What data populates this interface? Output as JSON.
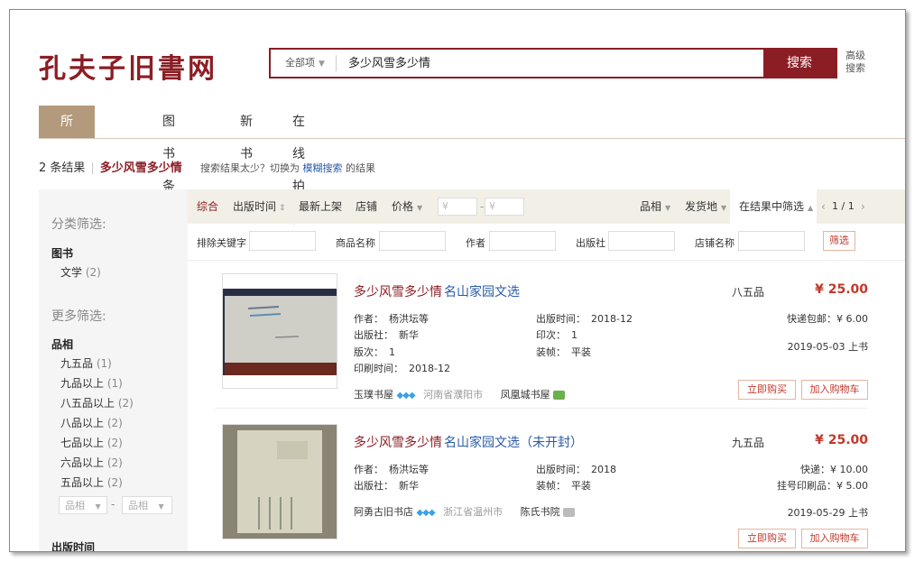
{
  "logo": "孔夫子旧書网",
  "search": {
    "scope": "全部项",
    "query": "多少风雪多少情",
    "button": "搜索",
    "advanced": "高级搜索"
  },
  "tabs": [
    "所有商品",
    "图书条目",
    "新书",
    "在线拍卖"
  ],
  "summary": {
    "count": "2 条结果",
    "keyword": "多少风雪多少情",
    "tip_prefix": "搜索结果太少？切换为",
    "tip_link": "模糊搜索",
    "tip_suffix": "的结果"
  },
  "sidebar": {
    "category_heading": "分类筛选:",
    "category_group": "图书",
    "category_items": [
      {
        "label": "文学",
        "count": "(2)"
      }
    ],
    "more_heading": "更多筛选:",
    "condition_group": "品相",
    "condition_items": [
      {
        "label": "九五品",
        "count": "(1)"
      },
      {
        "label": "九品以上",
        "count": "(1)"
      },
      {
        "label": "八五品以上",
        "count": "(2)"
      },
      {
        "label": "八品以上",
        "count": "(2)"
      },
      {
        "label": "七品以上",
        "count": "(2)"
      },
      {
        "label": "六品以上",
        "count": "(2)"
      },
      {
        "label": "五品以上",
        "count": "(2)"
      }
    ],
    "range_from": "品相",
    "range_dash": "-",
    "range_to": "品相",
    "pubtime_group": "出版时间"
  },
  "sortbar": {
    "comprehensive": "综合",
    "pubtime": "出版时间",
    "newest": "最新上架",
    "shop": "店铺",
    "price": "价格",
    "price_from": "¥",
    "price_dash": "-",
    "price_to": "¥",
    "condition": "品相",
    "ship_from": "发货地",
    "in_results": "在结果中筛选",
    "page": "1 / 1"
  },
  "filterrow": {
    "exclude": "排除关键字",
    "name": "商品名称",
    "author": "作者",
    "publisher": "出版社",
    "shopname": "店铺名称",
    "button": "筛选"
  },
  "items": [
    {
      "title_main": "多少风雪多少情",
      "title_sub": "名山家园文选",
      "author_k": "作者：",
      "author_v": "杨洪坛等",
      "pubtime_k": "出版时间：",
      "pubtime_v": "2018-12",
      "publisher_k": "出版社：",
      "publisher_v": "新华",
      "printing_k": "印次：",
      "printing_v": "1",
      "edition_k": "版次：",
      "edition_v": "1",
      "binding_k": "装帧：",
      "binding_v": "平装",
      "printtime_k": "印刷时间：",
      "printtime_v": "2018-12",
      "shop": "玉璞书屋",
      "location": "河南省濮阳市",
      "seller": "凤凰城书屋",
      "condition": "八五品",
      "price": "¥ 25.00",
      "ship1": "快递包邮：¥ 6.00",
      "ship2": "",
      "listed": "2019-05-03 上书",
      "buy": "立即购买",
      "cart": "加入购物车"
    },
    {
      "title_main": "多少风雪多少情",
      "title_sub": "名山家园文选（未开封）",
      "author_k": "作者：",
      "author_v": "杨洪坛等",
      "pubtime_k": "出版时间：",
      "pubtime_v": "2018",
      "publisher_k": "出版社：",
      "publisher_v": "新华",
      "binding_k": "装帧：",
      "binding_v": "平装",
      "shop": "阿勇古旧书店",
      "location": "浙江省温州市",
      "seller": "陈氏书院",
      "condition": "九五品",
      "price": "¥ 25.00",
      "ship1": "快递：¥ 10.00",
      "ship2": "挂号印刷品：¥ 5.00",
      "listed": "2019-05-29 上书",
      "buy": "立即购买",
      "cart": "加入购物车"
    }
  ],
  "colors": {
    "brand": "#8b1e24",
    "tab_active": "#b49a7c",
    "price": "#c0392b",
    "link": "#2a5ba8"
  }
}
